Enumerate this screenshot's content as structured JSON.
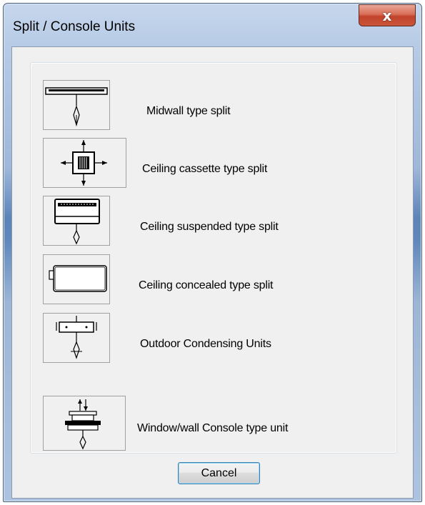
{
  "window": {
    "title": "Split / Console Units",
    "close_label": "x"
  },
  "units": [
    {
      "label": "Midwall type split",
      "icon": "midwall-split-icon"
    },
    {
      "label": "Ceiling cassette type split",
      "icon": "ceiling-cassette-icon"
    },
    {
      "label": "Ceiling suspended type split",
      "icon": "ceiling-suspended-icon"
    },
    {
      "label": "Ceiling concealed type split",
      "icon": "ceiling-concealed-icon"
    },
    {
      "label": "Outdoor Condensing Units",
      "icon": "outdoor-condensing-icon"
    },
    {
      "label": "Window/wall Console type unit",
      "icon": "window-console-icon"
    }
  ],
  "buttons": {
    "cancel": "Cancel"
  }
}
